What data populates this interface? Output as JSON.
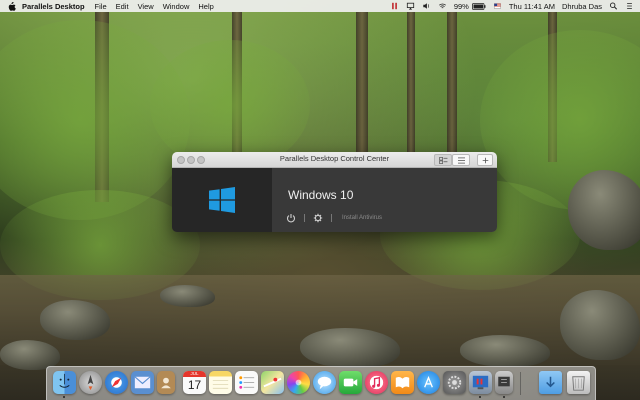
{
  "menubar": {
    "app_name": "Parallels Desktop",
    "menus": [
      "File",
      "Edit",
      "View",
      "Window",
      "Help"
    ],
    "battery": "99%",
    "clock": "Thu 11:41 AM",
    "user": "Dhruba Das"
  },
  "window": {
    "title": "Parallels Desktop Control Center",
    "vm": {
      "name": "Windows 10",
      "install_label": "Install Antivirus"
    }
  },
  "dock": {
    "calendar_month": "JUL",
    "calendar_day": "17",
    "apps": [
      "finder-icon",
      "launchpad-icon",
      "safari-icon",
      "mail-icon",
      "contacts-icon",
      "calendar-icon",
      "notes-icon",
      "reminders-icon",
      "maps-icon",
      "photos-icon",
      "messages-icon",
      "facetime-icon",
      "itunes-icon",
      "ibooks-icon",
      "app-store-icon",
      "system-preferences-icon",
      "parallels-icon",
      "downloads-folder-icon",
      "trash-icon"
    ]
  },
  "colors": {
    "window_dark": "#393939",
    "windows_blue": "#1f9ae0"
  }
}
